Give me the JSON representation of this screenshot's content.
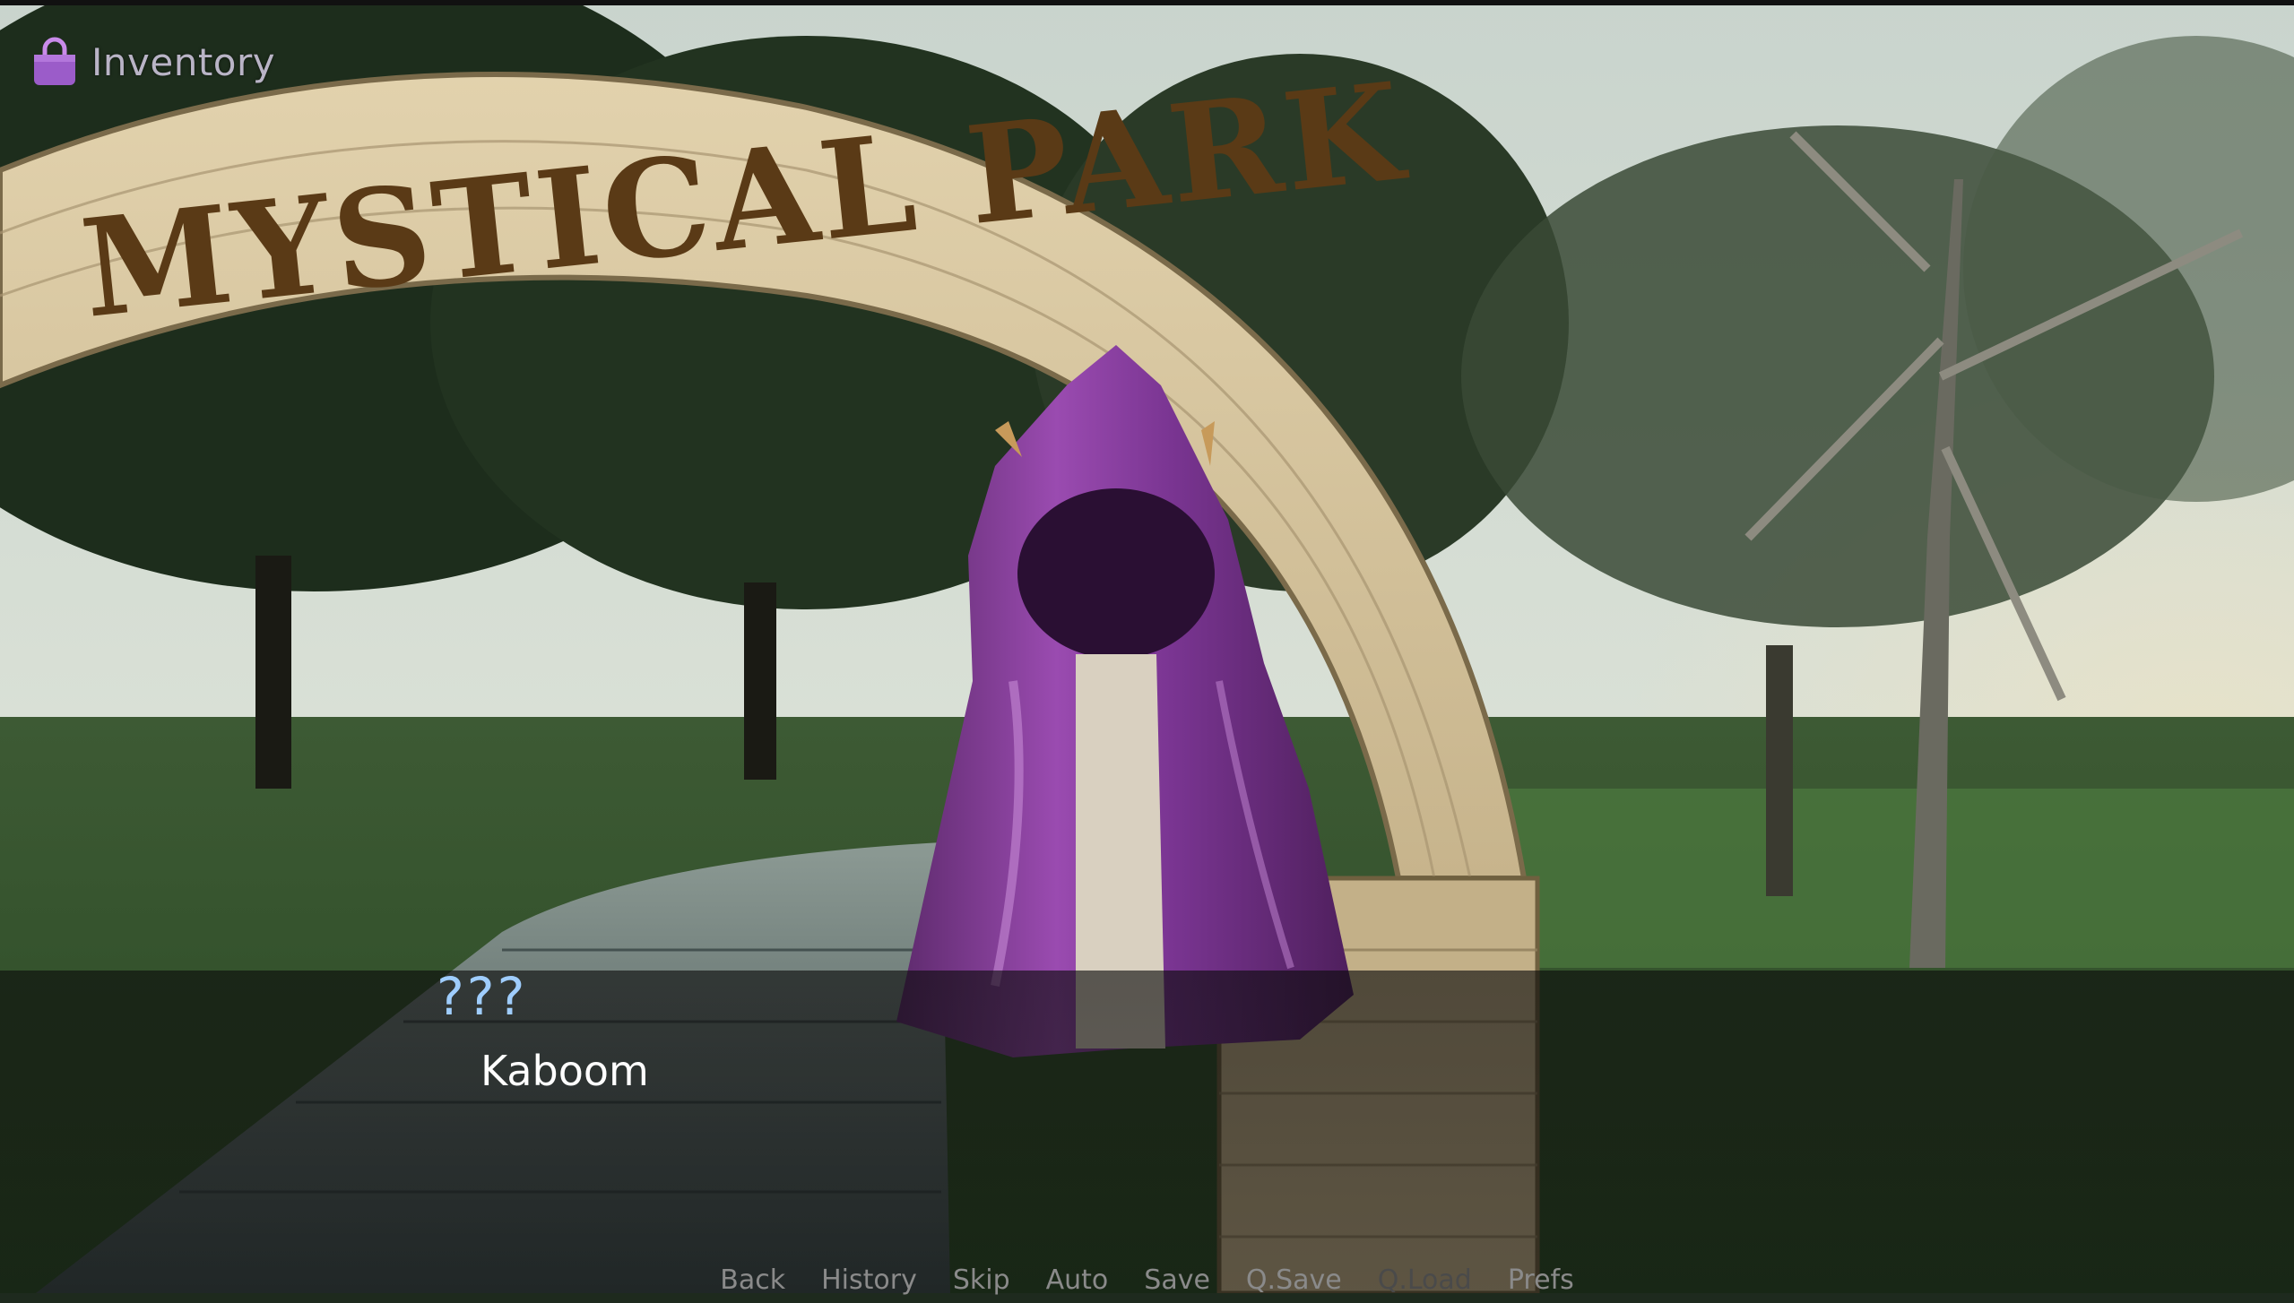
{
  "hud": {
    "inventory_label": "Inventory",
    "inventory_icon": "shopping-bag-icon",
    "accent_color": "#9b5cc9"
  },
  "scene": {
    "sign_text": "MYSTICAL PARK",
    "character": "purple-hooded-cloak-figure"
  },
  "dialogue": {
    "speaker": "???",
    "text": "Kaboom",
    "speaker_color": "#9fcdfd"
  },
  "quick_menu": {
    "back": "Back",
    "history": "History",
    "skip": "Skip",
    "auto": "Auto",
    "save": "Save",
    "qsave": "Q.Save",
    "qload": "Q.Load",
    "prefs": "Prefs",
    "qload_enabled": false
  }
}
